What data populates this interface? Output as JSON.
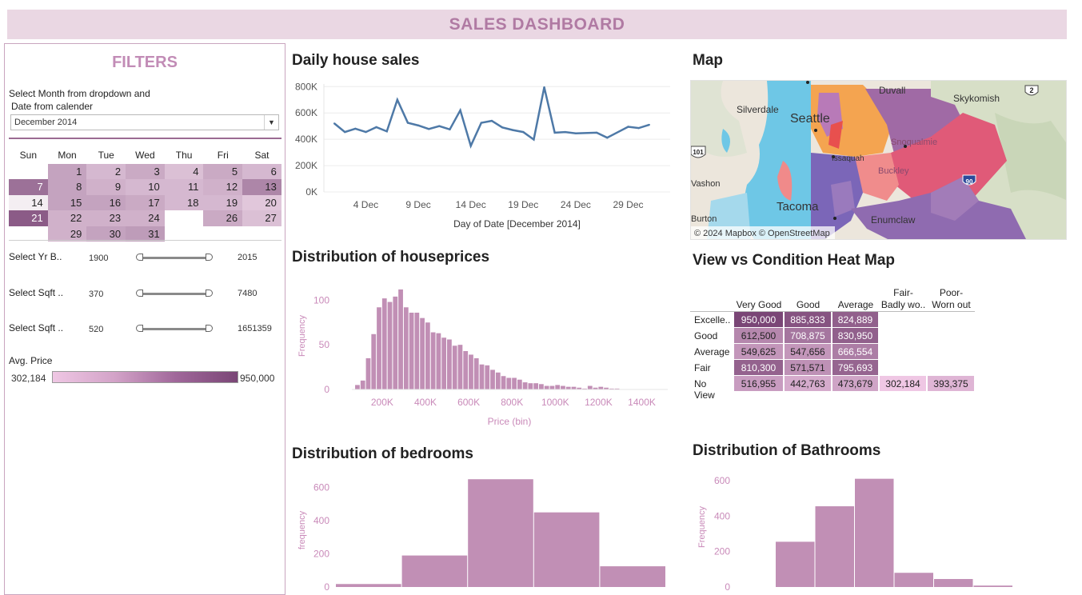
{
  "dashboard": {
    "title": "SALES DASHBOARD"
  },
  "colors": {
    "banner_bg": "#ead7e3",
    "banner_text": "#b07aa3",
    "line_series": "#4e79a7",
    "histogram_bar": "#c18fb5",
    "axis_text_pink": "#c98ab9",
    "heatmap_min": "#efc7e4",
    "heatmap_max": "#7a4676"
  },
  "filters": {
    "title": "FILTERS",
    "note_line1": "Select Month from dropdown and",
    "note_line2": "Date from calender",
    "month_selected": "December 2014",
    "calendar": {
      "days": [
        "Sun",
        "Mon",
        "Tue",
        "Wed",
        "Thu",
        "Fri",
        "Sat"
      ],
      "weeks": [
        [
          null,
          1,
          2,
          3,
          4,
          5,
          6
        ],
        [
          7,
          8,
          9,
          10,
          11,
          12,
          13
        ],
        [
          14,
          15,
          16,
          17,
          18,
          19,
          20
        ],
        [
          21,
          22,
          23,
          24,
          null,
          26,
          27
        ],
        [
          null,
          29,
          30,
          31,
          null,
          null,
          null
        ]
      ],
      "day_avg_price_level": {
        "1": 0.35,
        "2": 0.2,
        "3": 0.3,
        "4": 0.15,
        "5": 0.3,
        "6": 0.2,
        "7": 0.7,
        "8": 0.35,
        "9": 0.25,
        "10": 0.2,
        "11": 0.2,
        "12": 0.25,
        "13": 0.55,
        "14": 0.0,
        "15": 0.35,
        "16": 0.35,
        "17": 0.3,
        "18": 0.2,
        "19": 0.2,
        "20": 0.1,
        "21": 0.85,
        "22": 0.25,
        "23": 0.25,
        "24": 0.25,
        "26": 0.3,
        "27": 0.15,
        "29": 0.25,
        "30": 0.35,
        "31": 0.4
      }
    },
    "sliders": [
      {
        "label": "Select Yr B..",
        "min": "1900",
        "max": "2015"
      },
      {
        "label": "Select Sqft ..",
        "min": "370",
        "max": "7480"
      },
      {
        "label": "Select Sqft ..",
        "min": "520",
        "max": "1651359"
      }
    ],
    "legend": {
      "title": "Avg. Price",
      "min": "302,184",
      "max": "950,000"
    }
  },
  "panels": {
    "daily_sales_title": "Daily house sales",
    "map_title": "Map",
    "price_dist_title": "Distribution of houseprices",
    "heatmap_title": "View vs Condition Heat Map",
    "bedrooms_title": "Distribution of bedrooms",
    "bathrooms_title": "Distribution of Bathrooms"
  },
  "map": {
    "labels": [
      "Duvall",
      "Silverdale",
      "Seattle",
      "Skykomish",
      "Tacoma",
      "Buckley",
      "Enumclaw",
      "Snoqualmie",
      "Issaquah",
      "Vashon",
      "Burton"
    ],
    "shields": [
      "2",
      "90",
      "101"
    ],
    "attribution": "© 2024 Mapbox © OpenStreetMap"
  },
  "heatmap": {
    "col_headers": [
      [
        "Very Good"
      ],
      [
        "Good"
      ],
      [
        "Average"
      ],
      [
        "Fair-",
        "Badly wo.."
      ],
      [
        "Poor-",
        "Worn out"
      ]
    ],
    "rows": [
      {
        "label": "Excelle..",
        "values": [
          "950,000",
          "885,833",
          "824,889",
          null,
          null
        ],
        "levels": [
          1.0,
          0.9,
          0.8,
          null,
          null
        ]
      },
      {
        "label": "Good",
        "values": [
          "612,500",
          "708,875",
          "830,950",
          null,
          null
        ],
        "levels": [
          0.5,
          0.63,
          0.8,
          null,
          null
        ]
      },
      {
        "label": "Average",
        "values": [
          "549,625",
          "547,656",
          "666,554",
          null,
          null
        ],
        "levels": [
          0.38,
          0.38,
          0.57,
          null,
          null
        ]
      },
      {
        "label": "Fair",
        "values": [
          "810,300",
          "571,571",
          "795,693",
          null,
          null
        ],
        "levels": [
          0.78,
          0.42,
          0.76,
          null,
          null
        ]
      },
      {
        "label": "No View",
        "values": [
          "516,955",
          "442,763",
          "473,679",
          "302,184",
          "393,375"
        ],
        "levels": [
          0.33,
          0.22,
          0.27,
          0.0,
          0.14
        ]
      }
    ]
  },
  "chart_data": [
    {
      "type": "line",
      "title": "Daily house sales",
      "xlabel": "Day of Date [December 2014]",
      "ylabel": "",
      "x": [
        1,
        2,
        3,
        4,
        5,
        6,
        7,
        8,
        9,
        10,
        11,
        12,
        13,
        14,
        15,
        16,
        17,
        18,
        19,
        20,
        21,
        22,
        23,
        24,
        26,
        27,
        29,
        30,
        31
      ],
      "values": [
        520000,
        455000,
        480000,
        455000,
        492000,
        460000,
        700000,
        525000,
        505000,
        478000,
        500000,
        475000,
        620000,
        350000,
        525000,
        540000,
        490000,
        470000,
        455000,
        398000,
        795000,
        450000,
        455000,
        445000,
        450000,
        412000,
        495000,
        485000,
        510000
      ],
      "x_tick_labels": [
        "4 Dec",
        "9 Dec",
        "14 Dec",
        "19 Dec",
        "24 Dec",
        "29 Dec"
      ],
      "x_tick_values": [
        4,
        9,
        14,
        19,
        24,
        29
      ],
      "y_tick_labels": [
        "0K",
        "200K",
        "400K",
        "600K",
        "800K"
      ],
      "y_tick_values": [
        0,
        200000,
        400000,
        600000,
        800000
      ],
      "ylim": [
        0,
        820000
      ],
      "xlim": [
        0,
        33
      ]
    },
    {
      "type": "bar",
      "title": "Distribution of houseprices",
      "xlabel": "Price (bin)",
      "ylabel": "Frequency",
      "bin_start": 75000,
      "bin_width": 25000,
      "values": [
        5,
        10,
        35,
        62,
        92,
        102,
        98,
        104,
        112,
        92,
        86,
        86,
        80,
        75,
        64,
        63,
        58,
        56,
        49,
        50,
        43,
        39,
        35,
        28,
        27,
        22,
        19,
        15,
        13,
        13,
        11,
        8,
        7,
        7,
        6,
        4,
        4,
        5,
        4,
        3,
        3,
        2,
        1,
        4,
        2,
        3,
        2,
        1,
        1
      ],
      "x_tick_labels": [
        "200K",
        "400K",
        "600K",
        "800K",
        "1000K",
        "1200K",
        "1400K"
      ],
      "x_tick_values": [
        200000,
        400000,
        600000,
        800000,
        1000000,
        1200000,
        1400000
      ],
      "y_tick_labels": [
        "0",
        "50",
        "100"
      ],
      "y_tick_values": [
        0,
        50,
        100
      ],
      "ylim": [
        0,
        120
      ],
      "xlim": [
        60000,
        1520000
      ]
    },
    {
      "type": "bar",
      "title": "Distribution of bedrooms",
      "xlabel": "",
      "ylabel": "frequency",
      "values": [
        18,
        190,
        650,
        450,
        125
      ],
      "y_tick_labels": [
        "0",
        "200",
        "400",
        "600"
      ],
      "y_tick_values": [
        0,
        200,
        400,
        600
      ],
      "ylim": [
        0,
        680
      ]
    },
    {
      "type": "bar",
      "title": "Distribution of Bathrooms",
      "xlabel": "",
      "ylabel": "Frequency",
      "values": [
        255,
        455,
        610,
        80,
        45,
        8
      ],
      "y_tick_labels": [
        "0",
        "200",
        "400",
        "600"
      ],
      "y_tick_values": [
        0,
        200,
        400,
        600
      ],
      "ylim": [
        0,
        640
      ]
    }
  ]
}
